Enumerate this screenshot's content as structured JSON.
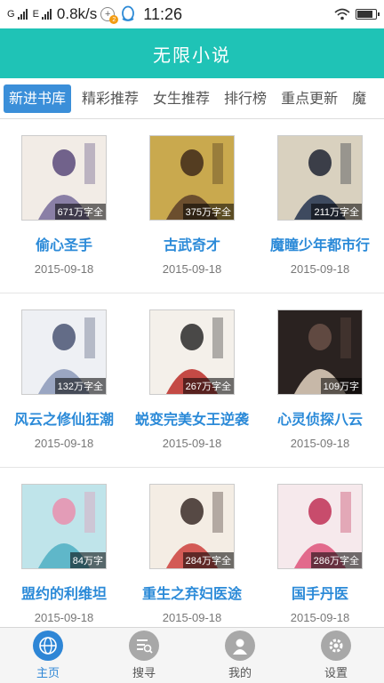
{
  "status_bar": {
    "carrier1": "G",
    "carrier2": "E",
    "speed": "0.8k/s",
    "notif_count": "2",
    "time": "11:26"
  },
  "header": {
    "title": "无限小说"
  },
  "tabs": [
    "新进书库",
    "精彩推荐",
    "女生推荐",
    "排行榜",
    "重点更新",
    "魔"
  ],
  "books": [
    {
      "title": "偷心圣手",
      "date": "2015-09-18",
      "count": "671万字全",
      "colors": [
        "#f2ece6",
        "#8a7fa6",
        "#5a4a7a"
      ]
    },
    {
      "title": "古武奇才",
      "date": "2015-09-18",
      "count": "375万字全",
      "colors": [
        "#c9a94e",
        "#6b4e2e",
        "#3f2a1a"
      ]
    },
    {
      "title": "魔瞳少年都市行",
      "date": "2015-09-18",
      "count": "211万字全",
      "colors": [
        "#d9d1bf",
        "#3e4a5f",
        "#1f2533"
      ]
    },
    {
      "title": "风云之修仙狂潮",
      "date": "2015-09-18",
      "count": "132万字全",
      "colors": [
        "#eef0f4",
        "#9aa6c2",
        "#4a5573"
      ]
    },
    {
      "title": "蜕变完美女王逆袭",
      "date": "2015-09-18",
      "count": "267万字全",
      "colors": [
        "#f4f0ea",
        "#c44a45",
        "#2a2a2a"
      ]
    },
    {
      "title": "心灵侦探八云",
      "date": "2015-09-18",
      "count": "109万字",
      "colors": [
        "#2a2220",
        "#c7b8a8",
        "#6a5048"
      ]
    },
    {
      "title": "盟约的利维坦",
      "date": "2015-09-18",
      "count": "84万字",
      "colors": [
        "#bfe4ea",
        "#5fb7c9",
        "#e98fae"
      ]
    },
    {
      "title": "重生之弃妇医途",
      "date": "2015-09-18",
      "count": "284万字全",
      "colors": [
        "#f4ede4",
        "#d35a55",
        "#3a2b28"
      ]
    },
    {
      "title": "国手丹医",
      "date": "2015-09-18",
      "count": "286万字全",
      "colors": [
        "#f6e9ec",
        "#e26a8c",
        "#bf3056"
      ]
    }
  ],
  "bottom_nav": [
    {
      "label": "主页",
      "icon": "globe-icon",
      "active": true
    },
    {
      "label": "搜寻",
      "icon": "search-list-icon",
      "active": false
    },
    {
      "label": "我的",
      "icon": "user-icon",
      "active": false
    },
    {
      "label": "设置",
      "icon": "gear-icon",
      "active": false
    }
  ],
  "colors": {
    "accent": "#1fc3b6",
    "tab_active": "#3b8fd9",
    "link": "#2b8ad8"
  }
}
